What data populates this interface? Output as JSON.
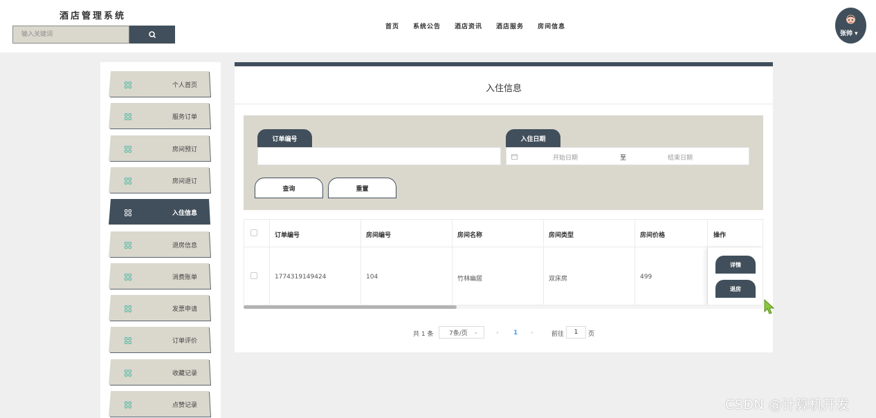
{
  "header": {
    "site_title": "酒店管理系统",
    "search_placeholder": "输入关键词",
    "nav": [
      "首页",
      "系统公告",
      "酒店资讯",
      "酒店服务",
      "房间信息"
    ],
    "user_name": "张帅",
    "user_caret": "▾"
  },
  "sidebar": {
    "items": [
      {
        "label": "个人首页",
        "active": false
      },
      {
        "label": "服务订单",
        "active": false
      },
      {
        "label": "房间预订",
        "active": false
      },
      {
        "label": "房间退订",
        "active": false
      },
      {
        "label": "入住信息",
        "active": true
      },
      {
        "label": "退房信息",
        "active": false
      },
      {
        "label": "消费账单",
        "active": false
      },
      {
        "label": "发票申请",
        "active": false
      },
      {
        "label": "订单评价",
        "active": false
      },
      {
        "label": "收藏记录",
        "active": false
      },
      {
        "label": "点赞记录",
        "active": false
      }
    ]
  },
  "main": {
    "title": "入住信息",
    "filter": {
      "order_no_label": "订单编号",
      "order_no_value": "",
      "checkin_date_label": "入住日期",
      "start_date_placeholder": "开始日期",
      "date_separator": "至",
      "end_date_placeholder": "结束日期",
      "query_button": "查询",
      "reset_button": "重置"
    },
    "table": {
      "headers": [
        "订单编号",
        "房间编号",
        "房间名称",
        "房间类型",
        "房间价格",
        "操作"
      ],
      "rows": [
        {
          "order_no": "1774319149424",
          "room_no": "104",
          "room_name": "竹林幽居",
          "room_type": "双床房",
          "room_price": "499",
          "actions": [
            "详情",
            "退房"
          ]
        }
      ]
    },
    "pagination": {
      "total_text": "共 1 条",
      "page_size": "7条/页",
      "prev": "‹",
      "current_page": "1",
      "next": "›",
      "goto_prefix": "前往",
      "goto_value": "1",
      "goto_suffix": "页"
    }
  },
  "watermark": "CSDN @计算机开发",
  "colors": {
    "primary": "#404f5b",
    "panel": "#dad7cd",
    "accent_icon": "#4fb8a8",
    "page_link": "#409eff"
  }
}
